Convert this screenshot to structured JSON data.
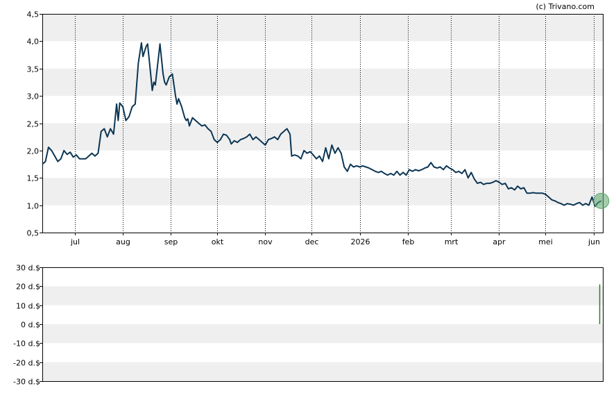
{
  "watermark": "(c) Trivano.com",
  "chart_data": [
    {
      "type": "line",
      "name": "price-chart",
      "ylim": [
        0.5,
        4.5
      ],
      "y_ticks": [
        {
          "value": 0.5,
          "label": "0,5"
        },
        {
          "value": 1.0,
          "label": "1,0"
        },
        {
          "value": 1.5,
          "label": "1,5"
        },
        {
          "value": 2.0,
          "label": "2,0"
        },
        {
          "value": 2.5,
          "label": "2,5"
        },
        {
          "value": 3.0,
          "label": "3,0"
        },
        {
          "value": 3.5,
          "label": "3,5"
        },
        {
          "value": 4.0,
          "label": "4,0"
        },
        {
          "value": 4.5,
          "label": "4,5"
        }
      ],
      "x_ticks": [
        {
          "date": "2025-07-01",
          "label": "jul"
        },
        {
          "date": "2025-08-01",
          "label": "aug"
        },
        {
          "date": "2025-09-01",
          "label": "sep"
        },
        {
          "date": "2025-10-01",
          "label": "okt"
        },
        {
          "date": "2025-11-01",
          "label": "nov"
        },
        {
          "date": "2025-12-01",
          "label": "dec"
        },
        {
          "date": "2026-01-01",
          "label": "2026"
        },
        {
          "date": "2026-02-01",
          "label": "feb"
        },
        {
          "date": "2026-03-01",
          "label": "mrt"
        },
        {
          "date": "2026-04-01",
          "label": "apr"
        },
        {
          "date": "2026-05-01",
          "label": "mei"
        },
        {
          "date": "2026-06-01",
          "label": "jun"
        }
      ],
      "x_range": [
        "2025-06-10",
        "2026-06-07"
      ],
      "grid": "alternating horizontal bands, dotted vertical lines at month starts",
      "line_color": "#0b3553",
      "marker_color": "#5aa469",
      "series": [
        {
          "points": [
            [
              "2025-06-10",
              1.75
            ],
            [
              "2025-06-12",
              1.8
            ],
            [
              "2025-06-14",
              2.06
            ],
            [
              "2025-06-16",
              2.0
            ],
            [
              "2025-06-18",
              1.9
            ],
            [
              "2025-06-20",
              1.8
            ],
            [
              "2025-06-22",
              1.85
            ],
            [
              "2025-06-24",
              2.0
            ],
            [
              "2025-06-26",
              1.93
            ],
            [
              "2025-06-28",
              1.97
            ],
            [
              "2025-06-30",
              1.88
            ],
            [
              "2025-07-02",
              1.92
            ],
            [
              "2025-07-04",
              1.85
            ],
            [
              "2025-07-06",
              1.85
            ],
            [
              "2025-07-08",
              1.85
            ],
            [
              "2025-07-10",
              1.9
            ],
            [
              "2025-07-12",
              1.95
            ],
            [
              "2025-07-14",
              1.9
            ],
            [
              "2025-07-16",
              1.95
            ],
            [
              "2025-07-18",
              2.35
            ],
            [
              "2025-07-20",
              2.4
            ],
            [
              "2025-07-22",
              2.25
            ],
            [
              "2025-07-24",
              2.4
            ],
            [
              "2025-07-26",
              2.3
            ],
            [
              "2025-07-28",
              2.85
            ],
            [
              "2025-07-29",
              2.55
            ],
            [
              "2025-07-30",
              2.87
            ],
            [
              "2025-08-01",
              2.8
            ],
            [
              "2025-08-03",
              2.55
            ],
            [
              "2025-08-05",
              2.62
            ],
            [
              "2025-08-07",
              2.8
            ],
            [
              "2025-08-09",
              2.85
            ],
            [
              "2025-08-11",
              3.6
            ],
            [
              "2025-08-13",
              3.97
            ],
            [
              "2025-08-14",
              3.72
            ],
            [
              "2025-08-16",
              3.9
            ],
            [
              "2025-08-17",
              3.95
            ],
            [
              "2025-08-19",
              3.4
            ],
            [
              "2025-08-20",
              3.1
            ],
            [
              "2025-08-21",
              3.25
            ],
            [
              "2025-08-22",
              3.2
            ],
            [
              "2025-08-24",
              3.7
            ],
            [
              "2025-08-25",
              3.95
            ],
            [
              "2025-08-27",
              3.4
            ],
            [
              "2025-08-28",
              3.25
            ],
            [
              "2025-08-29",
              3.2
            ],
            [
              "2025-08-31",
              3.35
            ],
            [
              "2025-09-02",
              3.4
            ],
            [
              "2025-09-04",
              3.0
            ],
            [
              "2025-09-05",
              2.85
            ],
            [
              "2025-09-06",
              2.95
            ],
            [
              "2025-09-08",
              2.8
            ],
            [
              "2025-09-10",
              2.6
            ],
            [
              "2025-09-11",
              2.55
            ],
            [
              "2025-09-12",
              2.58
            ],
            [
              "2025-09-13",
              2.45
            ],
            [
              "2025-09-15",
              2.6
            ],
            [
              "2025-09-17",
              2.55
            ],
            [
              "2025-09-19",
              2.5
            ],
            [
              "2025-09-21",
              2.45
            ],
            [
              "2025-09-23",
              2.47
            ],
            [
              "2025-09-25",
              2.4
            ],
            [
              "2025-09-27",
              2.35
            ],
            [
              "2025-09-29",
              2.2
            ],
            [
              "2025-10-01",
              2.15
            ],
            [
              "2025-10-03",
              2.2
            ],
            [
              "2025-10-05",
              2.3
            ],
            [
              "2025-10-07",
              2.28
            ],
            [
              "2025-10-09",
              2.2
            ],
            [
              "2025-10-10",
              2.12
            ],
            [
              "2025-10-12",
              2.18
            ],
            [
              "2025-10-14",
              2.15
            ],
            [
              "2025-10-16",
              2.2
            ],
            [
              "2025-10-18",
              2.22
            ],
            [
              "2025-10-20",
              2.25
            ],
            [
              "2025-10-22",
              2.3
            ],
            [
              "2025-10-24",
              2.2
            ],
            [
              "2025-10-26",
              2.25
            ],
            [
              "2025-10-28",
              2.2
            ],
            [
              "2025-10-30",
              2.15
            ],
            [
              "2025-11-01",
              2.1
            ],
            [
              "2025-11-03",
              2.2
            ],
            [
              "2025-11-05",
              2.22
            ],
            [
              "2025-11-07",
              2.25
            ],
            [
              "2025-11-09",
              2.2
            ],
            [
              "2025-11-11",
              2.3
            ],
            [
              "2025-11-13",
              2.35
            ],
            [
              "2025-11-15",
              2.4
            ],
            [
              "2025-11-17",
              2.3
            ],
            [
              "2025-11-18",
              1.9
            ],
            [
              "2025-11-20",
              1.92
            ],
            [
              "2025-11-22",
              1.9
            ],
            [
              "2025-11-24",
              1.85
            ],
            [
              "2025-11-26",
              2.0
            ],
            [
              "2025-11-28",
              1.95
            ],
            [
              "2025-11-30",
              1.98
            ],
            [
              "2025-12-02",
              1.92
            ],
            [
              "2025-12-04",
              1.85
            ],
            [
              "2025-12-06",
              1.9
            ],
            [
              "2025-12-08",
              1.8
            ],
            [
              "2025-12-10",
              2.05
            ],
            [
              "2025-12-12",
              1.85
            ],
            [
              "2025-12-14",
              2.1
            ],
            [
              "2025-12-16",
              1.95
            ],
            [
              "2025-12-18",
              2.05
            ],
            [
              "2025-12-20",
              1.95
            ],
            [
              "2025-12-22",
              1.7
            ],
            [
              "2025-12-24",
              1.62
            ],
            [
              "2025-12-26",
              1.75
            ],
            [
              "2025-12-28",
              1.7
            ],
            [
              "2025-12-30",
              1.72
            ],
            [
              "2026-01-01",
              1.7
            ],
            [
              "2026-01-03",
              1.72
            ],
            [
              "2026-01-05",
              1.7
            ],
            [
              "2026-01-07",
              1.68
            ],
            [
              "2026-01-09",
              1.65
            ],
            [
              "2026-01-11",
              1.62
            ],
            [
              "2026-01-13",
              1.6
            ],
            [
              "2026-01-15",
              1.62
            ],
            [
              "2026-01-17",
              1.58
            ],
            [
              "2026-01-19",
              1.55
            ],
            [
              "2026-01-21",
              1.58
            ],
            [
              "2026-01-23",
              1.55
            ],
            [
              "2026-01-25",
              1.62
            ],
            [
              "2026-01-27",
              1.55
            ],
            [
              "2026-01-29",
              1.6
            ],
            [
              "2026-01-31",
              1.55
            ],
            [
              "2026-02-02",
              1.65
            ],
            [
              "2026-02-04",
              1.62
            ],
            [
              "2026-02-06",
              1.65
            ],
            [
              "2026-02-08",
              1.63
            ],
            [
              "2026-02-10",
              1.65
            ],
            [
              "2026-02-12",
              1.68
            ],
            [
              "2026-02-14",
              1.7
            ],
            [
              "2026-02-16",
              1.78
            ],
            [
              "2026-02-18",
              1.7
            ],
            [
              "2026-02-20",
              1.68
            ],
            [
              "2026-02-22",
              1.7
            ],
            [
              "2026-02-24",
              1.65
            ],
            [
              "2026-02-26",
              1.72
            ],
            [
              "2026-02-28",
              1.68
            ],
            [
              "2026-03-02",
              1.65
            ],
            [
              "2026-03-04",
              1.6
            ],
            [
              "2026-03-06",
              1.62
            ],
            [
              "2026-03-08",
              1.58
            ],
            [
              "2026-03-10",
              1.65
            ],
            [
              "2026-03-12",
              1.5
            ],
            [
              "2026-03-14",
              1.6
            ],
            [
              "2026-03-16",
              1.48
            ],
            [
              "2026-03-18",
              1.4
            ],
            [
              "2026-03-20",
              1.42
            ],
            [
              "2026-03-22",
              1.38
            ],
            [
              "2026-03-24",
              1.4
            ],
            [
              "2026-03-26",
              1.4
            ],
            [
              "2026-03-28",
              1.42
            ],
            [
              "2026-03-30",
              1.45
            ],
            [
              "2026-04-01",
              1.42
            ],
            [
              "2026-04-03",
              1.38
            ],
            [
              "2026-04-05",
              1.4
            ],
            [
              "2026-04-07",
              1.3
            ],
            [
              "2026-04-09",
              1.32
            ],
            [
              "2026-04-11",
              1.28
            ],
            [
              "2026-04-13",
              1.35
            ],
            [
              "2026-04-15",
              1.3
            ],
            [
              "2026-04-17",
              1.32
            ],
            [
              "2026-04-19",
              1.22
            ],
            [
              "2026-04-21",
              1.22
            ],
            [
              "2026-04-23",
              1.23
            ],
            [
              "2026-04-25",
              1.22
            ],
            [
              "2026-04-27",
              1.22
            ],
            [
              "2026-04-29",
              1.22
            ],
            [
              "2026-05-01",
              1.2
            ],
            [
              "2026-05-03",
              1.15
            ],
            [
              "2026-05-05",
              1.1
            ],
            [
              "2026-05-07",
              1.08
            ],
            [
              "2026-05-09",
              1.05
            ],
            [
              "2026-05-11",
              1.03
            ],
            [
              "2026-05-13",
              1.0
            ],
            [
              "2026-05-15",
              1.03
            ],
            [
              "2026-05-17",
              1.02
            ],
            [
              "2026-05-19",
              1.0
            ],
            [
              "2026-05-21",
              1.03
            ],
            [
              "2026-05-23",
              1.05
            ],
            [
              "2026-05-25",
              1.0
            ],
            [
              "2026-05-27",
              1.03
            ],
            [
              "2026-05-29",
              1.0
            ],
            [
              "2026-05-31",
              1.15
            ],
            [
              "2026-06-02",
              0.98
            ],
            [
              "2026-06-04",
              1.05
            ],
            [
              "2026-06-06",
              1.08
            ]
          ]
        }
      ],
      "last_point": {
        "date": "2026-06-06",
        "value": 1.08
      }
    },
    {
      "type": "bar",
      "name": "volume-chart",
      "ylim": [
        -30,
        30
      ],
      "y_ticks": [
        {
          "value": 30,
          "label": "30 d.$"
        },
        {
          "value": 20,
          "label": "20 d.$"
        },
        {
          "value": 10,
          "label": "10 d.$"
        },
        {
          "value": 0,
          "label": "0 d.$"
        },
        {
          "value": -10,
          "label": "-10 d.$"
        },
        {
          "value": -20,
          "label": "-20 d.$"
        },
        {
          "value": -30,
          "label": "-30 d.$"
        }
      ],
      "x_range": [
        "2025-06-10",
        "2026-06-07"
      ],
      "bar_color": "#2e7d32",
      "bars": [
        {
          "date": "2026-06-05",
          "value": 21
        }
      ]
    }
  ]
}
